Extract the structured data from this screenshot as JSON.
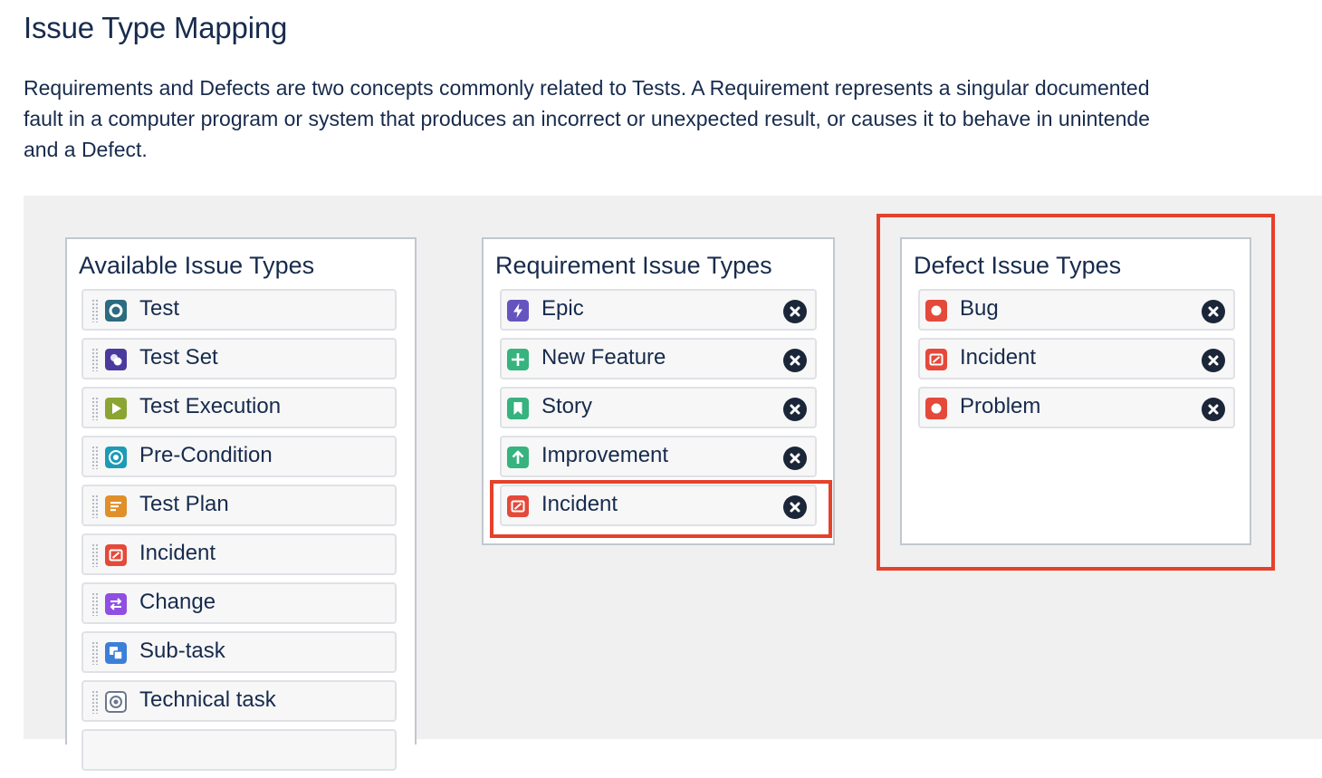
{
  "page": {
    "title": "Issue Type Mapping",
    "description_lines": [
      "Requirements and Defects are two concepts commonly related to Tests. A Requirement represents a singular documented",
      "fault in a computer program or system that produces an incorrect or unexpected result, or causes it to behave in unintende",
      "and a Defect."
    ]
  },
  "available": {
    "title": "Available Issue Types",
    "items": [
      {
        "label": "Test",
        "icon": "xray-test-icon",
        "color": "#2c6b80"
      },
      {
        "label": "Test Set",
        "icon": "xray-test-set-icon",
        "color": "#4b3a9e"
      },
      {
        "label": "Test Execution",
        "icon": "xray-test-execution-icon",
        "color": "#8aa532"
      },
      {
        "label": "Pre-Condition",
        "icon": "xray-precondition-icon",
        "color": "#1d9bb5"
      },
      {
        "label": "Test Plan",
        "icon": "xray-test-plan-icon",
        "color": "#e08f2a"
      },
      {
        "label": "Incident",
        "icon": "incident-icon",
        "color": "#e5493a"
      },
      {
        "label": "Change",
        "icon": "change-icon",
        "color": "#904ee2"
      },
      {
        "label": "Sub-task",
        "icon": "subtask-icon",
        "color": "#4bade8"
      },
      {
        "label": "Technical task",
        "icon": "technical-task-icon",
        "color": "#6b778c"
      }
    ]
  },
  "requirement": {
    "title": "Requirement Issue Types",
    "items": [
      {
        "label": "Epic",
        "icon": "epic-icon",
        "color": "#6554c0"
      },
      {
        "label": "New Feature",
        "icon": "new-feature-icon",
        "color": "#36b37e"
      },
      {
        "label": "Story",
        "icon": "story-icon",
        "color": "#36b37e"
      },
      {
        "label": "Improvement",
        "icon": "improvement-icon",
        "color": "#36b37e"
      },
      {
        "label": "Incident",
        "icon": "incident-icon",
        "color": "#e5493a"
      }
    ]
  },
  "defect": {
    "title": "Defect Issue Types",
    "items": [
      {
        "label": "Bug",
        "icon": "bug-icon",
        "color": "#e5493a"
      },
      {
        "label": "Incident",
        "icon": "incident-icon",
        "color": "#e5493a"
      },
      {
        "label": "Problem",
        "icon": "problem-icon",
        "color": "#e5493a"
      }
    ]
  },
  "highlight_color": "#e5412b"
}
